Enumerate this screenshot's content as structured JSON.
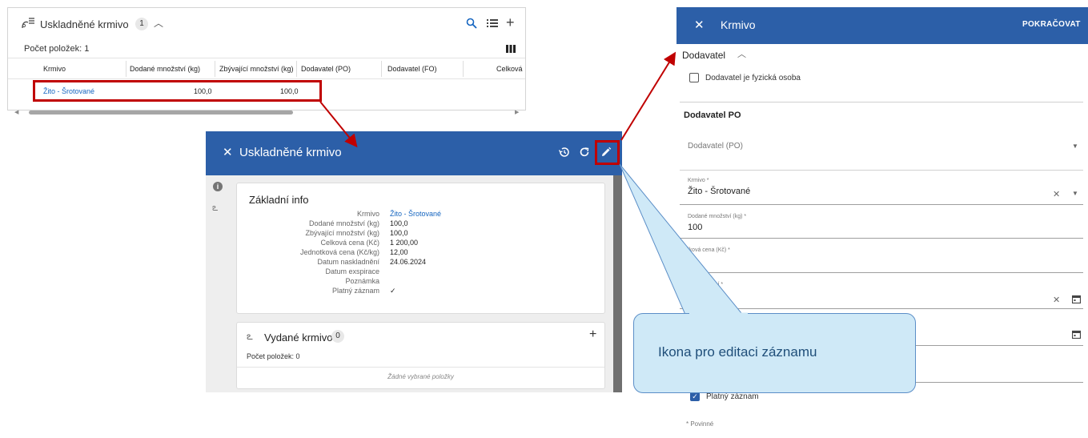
{
  "list": {
    "title": "Uskladněné krmivo",
    "badge": "1",
    "count_text": "Počet položek: 1",
    "columns": [
      "Krmivo",
      "Dodané množství (kg)",
      "Zbývající množství (kg)",
      "Dodavatel (PO)",
      "Dodavatel (FO)",
      "Celková"
    ],
    "row": {
      "feed": "Žito - Šrotované",
      "delivered": "100,0",
      "remaining": "100,0"
    },
    "icons": [
      "search-icon",
      "list-icon",
      "plus-icon",
      "columns-icon"
    ]
  },
  "detail": {
    "title": "Uskladněné krmivo",
    "basic_title": "Základní info",
    "fields": [
      {
        "label": "Krmivo",
        "value": "Žito - Šrotované"
      },
      {
        "label": "Dodané množství (kg)",
        "value": "100,0"
      },
      {
        "label": "Zbývající množství (kg)",
        "value": "100,0"
      },
      {
        "label": "Celková cena (Kč)",
        "value": "1 200,00"
      },
      {
        "label": "Jednotková cena (Kč/kg)",
        "value": "12,00"
      },
      {
        "label": "Datum naskladnění",
        "value": "24.06.2024"
      },
      {
        "label": "Datum exspirace",
        "value": ""
      },
      {
        "label": "Poznámka",
        "value": ""
      },
      {
        "label": "Platný záznam",
        "value": "✓"
      }
    ],
    "issued_title": "Vydané krmivo",
    "issued_badge": "0",
    "issued_count": "Počet položek: 0",
    "issued_empty": "Žádné vybrané položky",
    "icons": [
      "history-icon",
      "refresh-icon",
      "edit-icon"
    ]
  },
  "edit": {
    "title": "Krmivo",
    "continue": "POKRAČOVAT",
    "supplier_section": "Dodavatel",
    "physical_checkbox": "Dodavatel je fyzická osoba",
    "po_section": "Dodavatel PO",
    "po_placeholder": "Dodavatel (PO)",
    "feed_label": "Krmivo *",
    "feed_value": "Žito - Šrotované",
    "delivered_label": "Dodané množství (kg) *",
    "delivered_value": "100",
    "price_label": "lková cena (Kč) *",
    "price_value": "0",
    "date_label": "ndnění *",
    "valid_label": "Platný záznam",
    "required_note": "* Povinné"
  },
  "callout": {
    "text": "Ikona pro editaci záznamu"
  },
  "colors": {
    "header_blue": "#2c5fa8",
    "highlight_red": "#c00000",
    "link_blue": "#1565c0",
    "callout_fill": "#cfe9f7"
  }
}
